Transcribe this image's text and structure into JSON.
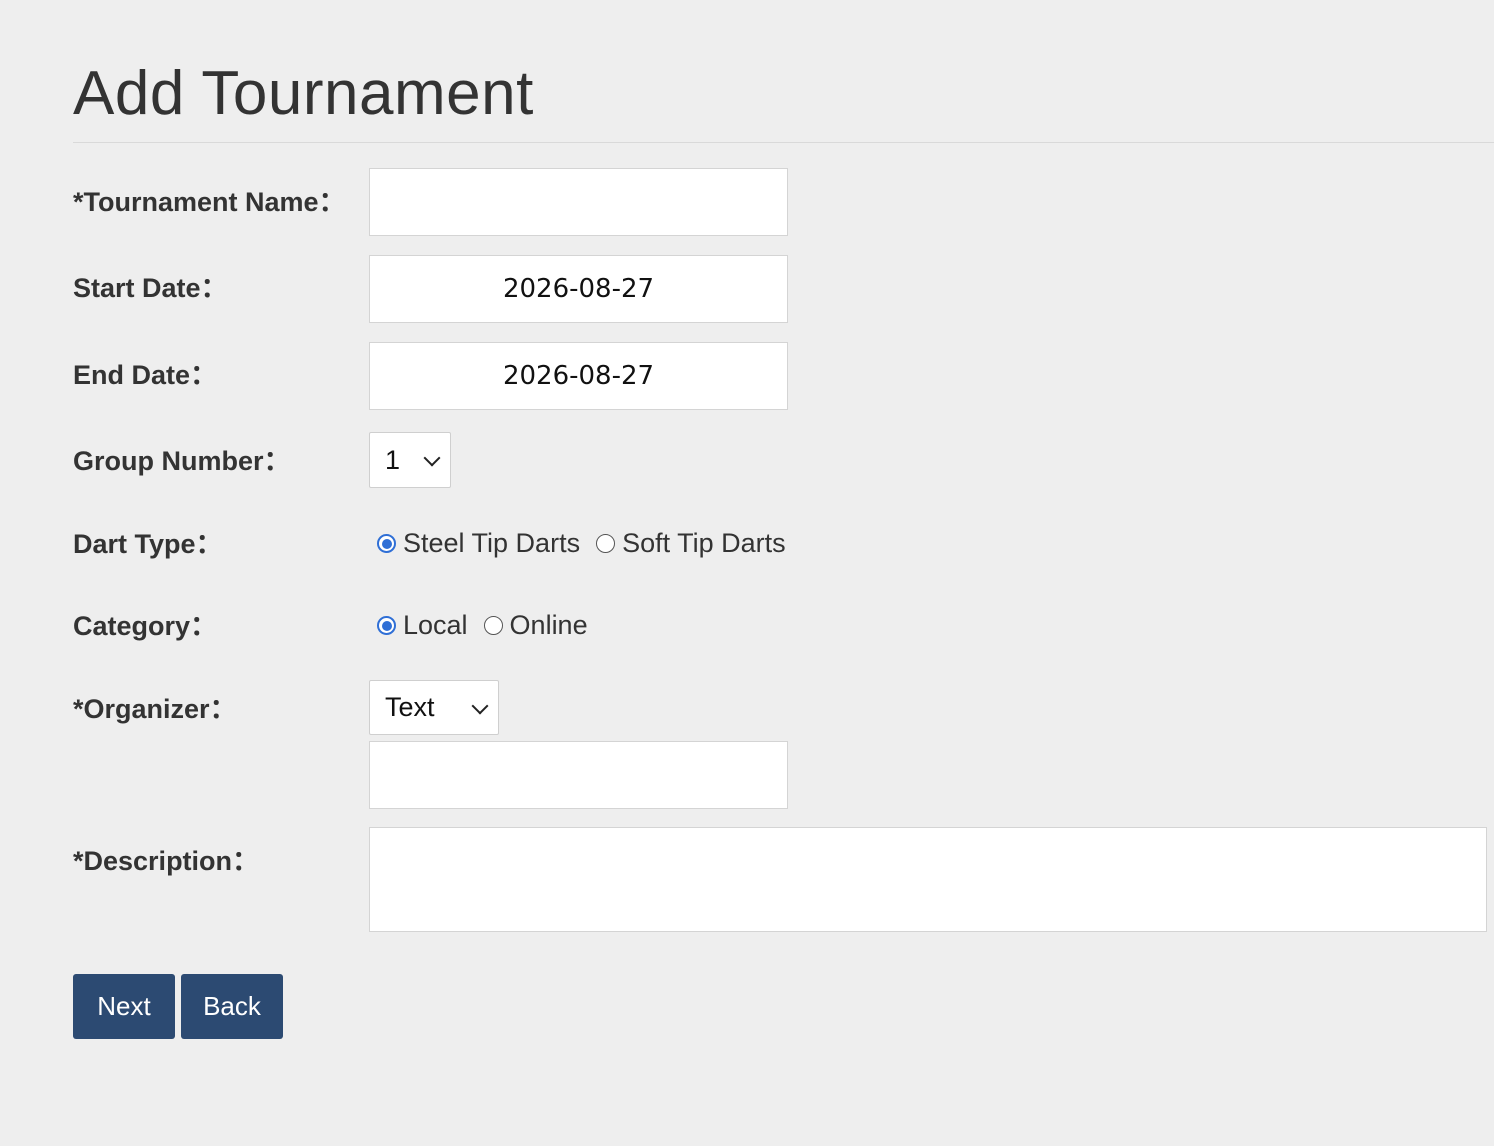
{
  "page": {
    "title": "Add Tournament"
  },
  "form": {
    "tournament_name": {
      "label": "*Tournament Name：",
      "value": ""
    },
    "start_date": {
      "label": "Start Date：",
      "value": "2026-08-27"
    },
    "end_date": {
      "label": "End Date：",
      "value": "2026-08-27"
    },
    "group_number": {
      "label": "Group Number：",
      "selected": "1"
    },
    "dart_type": {
      "label": "Dart Type：",
      "options": [
        "Steel Tip Darts",
        "Soft Tip Darts"
      ],
      "selected": "Steel Tip Darts"
    },
    "category": {
      "label": "Category：",
      "options": [
        "Local",
        "Online"
      ],
      "selected": "Local"
    },
    "organizer": {
      "label": "*Organizer：",
      "type_selected": "Text",
      "value": ""
    },
    "description": {
      "label": "*Description：",
      "value": ""
    }
  },
  "buttons": {
    "next": "Next",
    "back": "Back"
  },
  "colors": {
    "background": "#eeeeee",
    "button": "#2c4a72",
    "radio_accent": "#2f6fd6"
  }
}
